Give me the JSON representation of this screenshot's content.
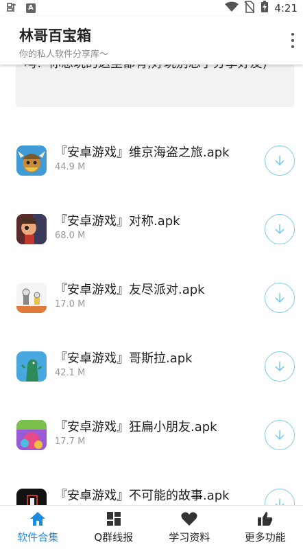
{
  "status_bar": {
    "time": "4:21",
    "left_icons": [
      "carrier-icon",
      "notification-a-icon"
    ],
    "right_icons": [
      "wifi-icon",
      "no-sim-icon",
      "battery-charging-icon"
    ],
    "notification_letter": "A"
  },
  "header": {
    "title": "林哥百宝箱",
    "subtitle": "你的私人软件分享库～",
    "menu_icon": "more-vert-icon"
  },
  "notice": {
    "text": "吗？你想玩的这里都有,好玩别忘了分享好友)"
  },
  "apps": [
    {
      "name": "『安卓游戏』维京海盗之旅.apk",
      "size": "44.9 M"
    },
    {
      "name": "『安卓游戏』对称.apk",
      "size": "68.0 M"
    },
    {
      "name": "『安卓游戏』友尽派对.apk",
      "size": "17.0 M"
    },
    {
      "name": "『安卓游戏』哥斯拉.apk",
      "size": "42.1 M"
    },
    {
      "name": "『安卓游戏』狂扁小朋友.apk",
      "size": "17.7 M"
    },
    {
      "name": "『安卓游戏』不可能的故事.apk",
      "size": ""
    }
  ],
  "nav": {
    "items": [
      {
        "label": "软件合集",
        "icon": "home-icon",
        "active": true
      },
      {
        "label": "Q群线报",
        "icon": "grid-icon",
        "active": false
      },
      {
        "label": "学习资料",
        "icon": "heart-icon",
        "active": false
      },
      {
        "label": "更多功能",
        "icon": "thumbs-up-icon",
        "active": false
      }
    ]
  },
  "colors": {
    "accent": "#1e8de0",
    "download_ring": "#7ccbe9",
    "nav_icon": "#333333"
  }
}
